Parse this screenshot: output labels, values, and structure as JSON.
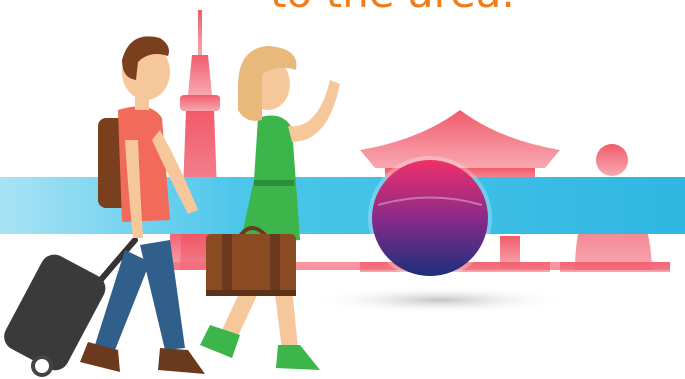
{
  "headline": {
    "text": "to the area."
  },
  "icons": {
    "tower": "namsan-tower-icon",
    "temple": "temple-roof-icon",
    "statue": "buddha-statue-icon",
    "emblem": "taegeuk-circle-icon",
    "luggage": "rolling-suitcase-icon",
    "bag": "travel-bag-icon"
  },
  "colors": {
    "headline": "#f07d1a",
    "landmarks": "#f0485a",
    "banner": "#3bbfe6",
    "emblem_red": "#e8255c",
    "emblem_blue": "#1c3d8f",
    "man_shirt": "#f26b5a",
    "man_pants": "#2f5f8a",
    "woman_dress": "#3cb54a",
    "suitcase": "#333333",
    "bag": "#8a4a22"
  }
}
